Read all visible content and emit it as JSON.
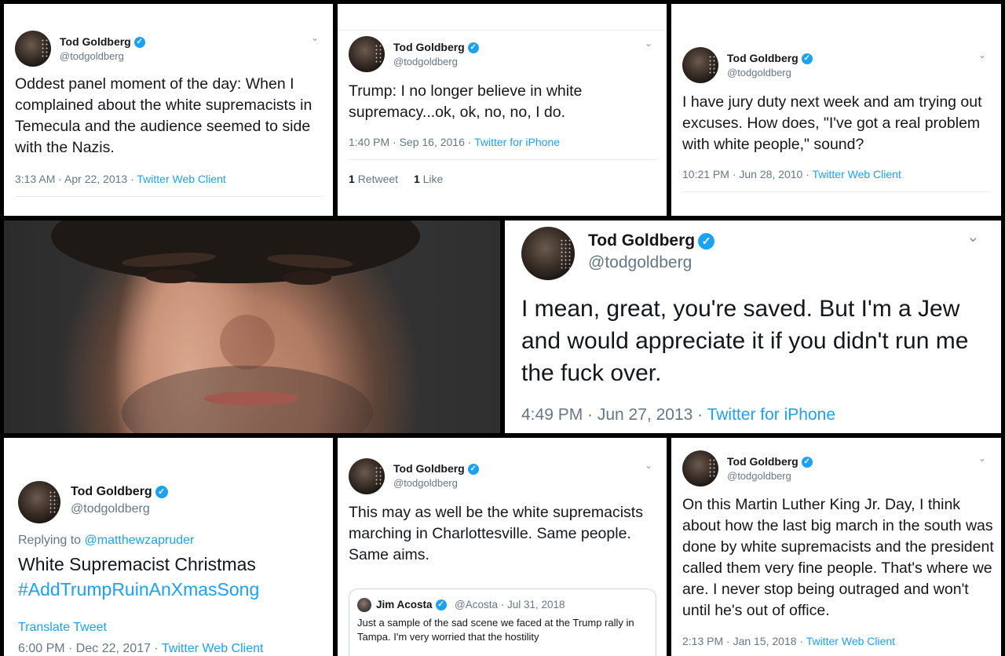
{
  "colors": {
    "accent": "#1da1f2",
    "text": "#14171a",
    "muted": "#657786",
    "background": "#000000"
  },
  "profile": {
    "name": "Tod Goldberg",
    "handle": "@todgoldberg",
    "verified_icon": "check-badge-icon"
  },
  "tweets": [
    {
      "text": "Oddest panel moment of the day: When I complained about the white supremacists in Temecula and the audience seemed to side with the Nazis.",
      "time": "3:13 AM · Apr 22, 2013 · ",
      "source": "Twitter Web Client"
    },
    {
      "text": "Trump: I no longer believe in white supremacy...ok, ok, no, no, I do.",
      "time": "1:40 PM · Sep 16, 2016 · ",
      "source": "Twitter for iPhone",
      "retweets_count": "1",
      "retweets_label": "Retweet",
      "likes_count": "1",
      "likes_label": "Like"
    },
    {
      "text": "I have jury duty next week and am trying out excuses. How does, \"I've got a real problem with white people,\" sound?",
      "time": "10:21 PM · Jun 28, 2010 · ",
      "source": "Twitter Web Client"
    },
    {
      "text": "I mean, great, you're saved. But I'm a Jew and would appreciate it if you didn't run me the fuck over.",
      "time": "4:49 PM · Jun 27, 2013 · ",
      "source": "Twitter for iPhone"
    },
    {
      "replying_prefix": "Replying to ",
      "replying_to": "@matthewzapruder",
      "text": "White Supremacist Christmas",
      "hashtag": "#AddTrumpRuinAnXmasSong",
      "translate": "Translate Tweet",
      "time": "6:00 PM · Dec 22, 2017 · ",
      "source": "Twitter Web Client"
    },
    {
      "text": "This may as well be the white supremacists marching in Charlottesville. Same people. Same aims.",
      "quoted": {
        "name": "Jim Acosta",
        "handle_date": "@Acosta · Jul 31, 2018",
        "text": "Just a sample of the sad scene we faced at the Trump rally in Tampa. I'm very worried that the hostility"
      }
    },
    {
      "text": "On this Martin Luther King Jr. Day, I think about how the last big march in the south was done by white supremacists and the president called them very fine people. That's where we are. I never stop being outraged and won't until he's out of office.",
      "time": "2:13 PM · Jan 15, 2018 · ",
      "source": "Twitter Web Client"
    }
  ]
}
